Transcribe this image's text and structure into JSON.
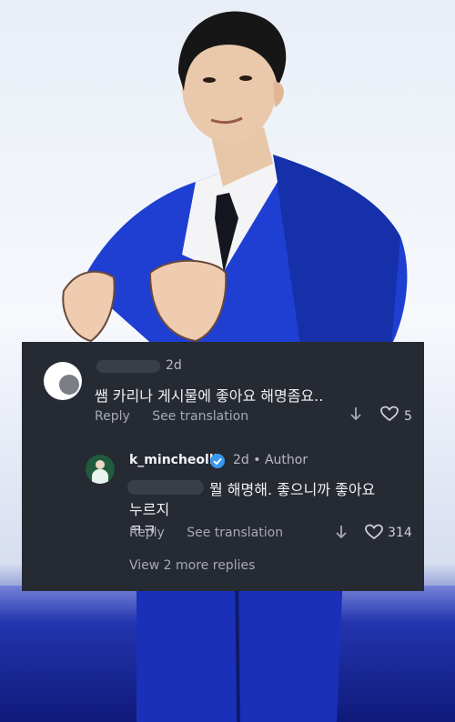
{
  "comment": {
    "time": "2d",
    "text": "쌤 카리나 게시물에 좋아요 해명좀요..",
    "reply_label": "Reply",
    "translate_label": "See translation",
    "likes": "5"
  },
  "reply": {
    "username": "k_mincheolll",
    "time": "2d",
    "separator": "•",
    "author_label": "Author",
    "text_line1": "뭘 해명해. 좋으니까 좋아요 누르지",
    "text_line2": "ㅋㅋ",
    "reply_label": "Reply",
    "translate_label": "See translation",
    "likes": "314",
    "view_more": "View 2 more replies"
  },
  "colors": {
    "card_bg": "#262a33",
    "suit_blue": "#1b3cc9",
    "verified_blue": "#3897f0"
  },
  "icons": [
    "down-arrow-icon",
    "heart-icon",
    "verified-badge-icon"
  ]
}
